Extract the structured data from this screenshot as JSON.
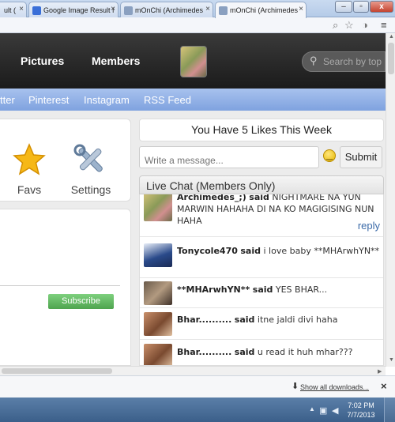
{
  "browser": {
    "tabs": [
      {
        "label": "ult (",
        "active": false
      },
      {
        "label": "Google Image Result f",
        "active": false
      },
      {
        "label": "mOnChi (Archimedes",
        "active": false
      },
      {
        "label": "mOnChi (Archimedes",
        "active": true
      }
    ],
    "tab_close": "×",
    "window_buttons": {
      "minimize": "–",
      "maximize": "▫",
      "close": "x"
    },
    "toolbar_icons": [
      "zoom-icon",
      "star-icon",
      "extension-icon",
      "menu-icon"
    ]
  },
  "site": {
    "nav": [
      {
        "label": "Pictures"
      },
      {
        "label": "Members"
      }
    ],
    "search_placeholder": "Search by top"
  },
  "social": [
    "tter",
    "Pinterest",
    "Instagram",
    "RSS Feed"
  ],
  "left": {
    "quick_links": [
      {
        "label": "Favs",
        "icon": "star-icon"
      },
      {
        "label": "Settings",
        "icon": "tools-icon"
      }
    ],
    "subscribe_label": "Subscribe"
  },
  "right": {
    "likes_text": "You Have 5 Likes This Week",
    "message_placeholder": "Write a message...",
    "submit_label": "Submit",
    "live_chat_title": "Live Chat (Members Only)",
    "reply_label": "reply",
    "chat": [
      {
        "user": "Archimedes_;)",
        "said": "said",
        "message": "NIGHTMARE NA YUN MARWIN HAHAHA DI NA KO MAGIGISING NUN HAHA"
      },
      {
        "user": "Tonycole470",
        "said": "said",
        "message": "i love baby **MHArwhYN**"
      },
      {
        "user": "**MHArwhYN**",
        "said": "said",
        "message": "YES BHAR..."
      },
      {
        "user": "Bhar..........",
        "said": "said",
        "message": "itne jaldi divi haha"
      },
      {
        "user": "Bhar..........",
        "said": "said",
        "message": "u read it huh mhar???"
      }
    ]
  },
  "downloads": {
    "link_label": "Show all downloads...",
    "close": "×"
  },
  "taskbar": {
    "time": "7:02 PM",
    "date": "7/7/2013"
  }
}
